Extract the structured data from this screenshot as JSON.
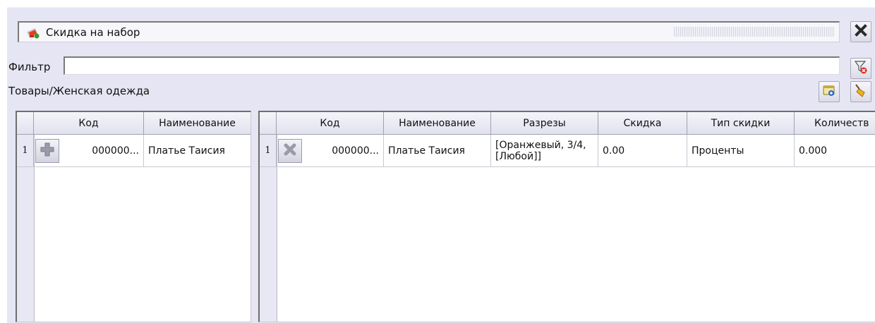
{
  "window": {
    "title": "Скидка на набор"
  },
  "filter": {
    "label": "Фильтр",
    "value": ""
  },
  "breadcrumb": "Товары/Женская одежда",
  "left_grid": {
    "columns": [
      "Код",
      "Наименование"
    ],
    "rows": [
      {
        "num": "1",
        "code": "000000...",
        "name": "Платье Таисия"
      }
    ]
  },
  "right_grid": {
    "columns": [
      "Код",
      "Наименование",
      "Разрезы",
      "Скидка",
      "Тип скидки",
      "Количеств"
    ],
    "rows": [
      {
        "num": "1",
        "code": "000000...",
        "name": "Платье Таисия",
        "cuts_line1": "[Оранжевый, 3/4,",
        "cuts_line2": "[Любой]]",
        "discount": "0.00",
        "discount_type": "Проценты",
        "quantity": "0.000"
      }
    ]
  },
  "icons": {
    "title": "discount-tag-icon",
    "close": "close-x-icon",
    "filter_clear": "filter-clear-icon",
    "new": "new-document-icon",
    "broom": "broom-icon",
    "add": "plus-icon",
    "remove": "cross-icon"
  }
}
